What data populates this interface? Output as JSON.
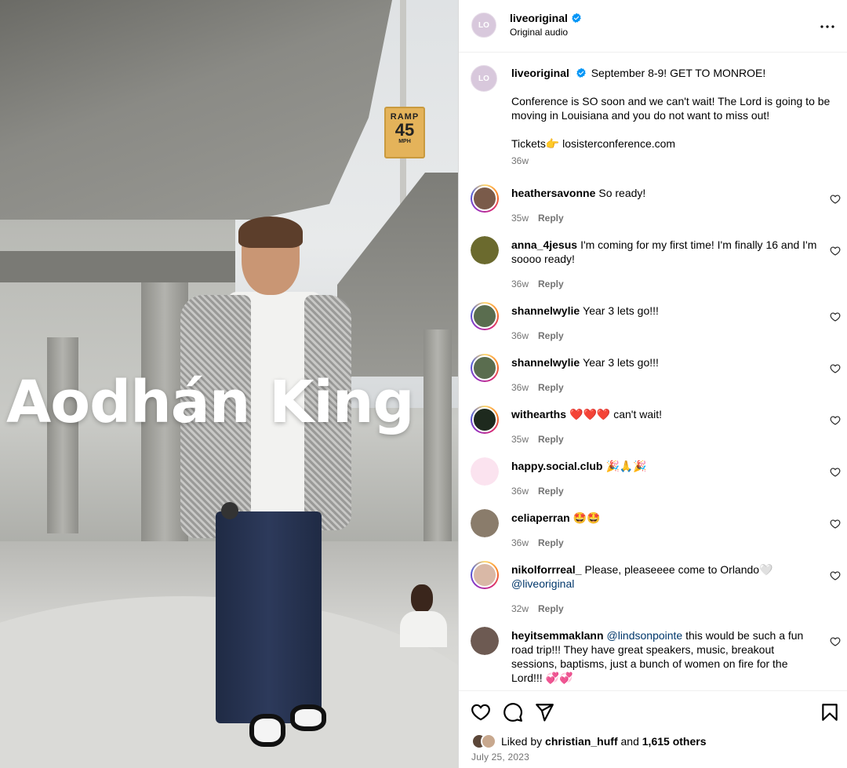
{
  "post": {
    "video_overlay_title": "Aodhán King",
    "road_sign": {
      "top": "RAMP",
      "number": "45",
      "bottom": "MPH"
    }
  },
  "header": {
    "username": "liveoriginal",
    "audio_label": "Original audio",
    "avatar_initials": "LO"
  },
  "caption": {
    "username": "liveoriginal",
    "avatar_initials": "LO",
    "line1": "September 8-9! GET TO MONROE!",
    "paragraph2": "Conference is SO soon and we can't wait! The Lord is going to be moving in Louisiana and you do not want to miss out!",
    "tickets_label": "Tickets👉",
    "tickets_link": "losisterconference.com",
    "time": "36w"
  },
  "comments": [
    {
      "username": "heathersavonne",
      "text": "So ready!",
      "time": "35w",
      "reply": "Reply",
      "avatar_color": "#7a5b4a",
      "ring": true
    },
    {
      "username": "anna_4jesus",
      "text": "I'm coming for my first time! I'm finally 16 and I'm soooo ready!",
      "time": "36w",
      "reply": "Reply",
      "avatar_color": "#6b6a2e",
      "ring": false
    },
    {
      "username": "shannelwylie",
      "text": "Year 3 lets go!!!",
      "time": "36w",
      "reply": "Reply",
      "avatar_color": "#5a6d4f",
      "ring": true
    },
    {
      "username": "shannelwylie",
      "text": "Year 3 lets go!!!",
      "time": "36w",
      "reply": "Reply",
      "avatar_color": "#5a6d4f",
      "ring": true
    },
    {
      "username": "withearths",
      "text": "❤️❤️❤️ can't wait!",
      "time": "35w",
      "reply": "Reply",
      "avatar_color": "#1e2a1e",
      "ring": true
    },
    {
      "username": "happy.social.club",
      "text": "🎉🙏🎉",
      "time": "36w",
      "reply": "Reply",
      "avatar_color": "#fbe3ef",
      "ring": false
    },
    {
      "username": "celiaperran",
      "text": "🤩🤩",
      "time": "36w",
      "reply": "Reply",
      "avatar_color": "#8a7c6b",
      "ring": false
    },
    {
      "username": "nikolforrreal_",
      "text": "Please, pleaseeee come to Orlando🤍",
      "mention": "@liveoriginal",
      "time": "32w",
      "reply": "Reply",
      "avatar_color": "#d9b8a6",
      "ring": true
    },
    {
      "username": "heyitsemmaklann",
      "mention": "@lindsonpointe",
      "text": "this would be such a fun road trip!!! They have great speakers, music, breakout sessions, baptisms, just a bunch of women on fire for the Lord!!! 💞💞",
      "avatar_color": "#6d5a52",
      "ring": false
    }
  ],
  "actions": {
    "liked_by_prefix": "Liked by",
    "liked_by_user": "christian_huff",
    "and_label": "and",
    "others_count": "1,615 others",
    "date": "July 25, 2023"
  },
  "icons": {
    "more": "more-options-icon",
    "like": "heart-icon",
    "comment": "comment-icon",
    "share": "share-icon",
    "save": "bookmark-icon",
    "verified": "verified-badge-icon"
  },
  "colors": {
    "verified_blue": "#0095f6",
    "meta_gray": "#737373",
    "mention_blue": "#00376b"
  }
}
